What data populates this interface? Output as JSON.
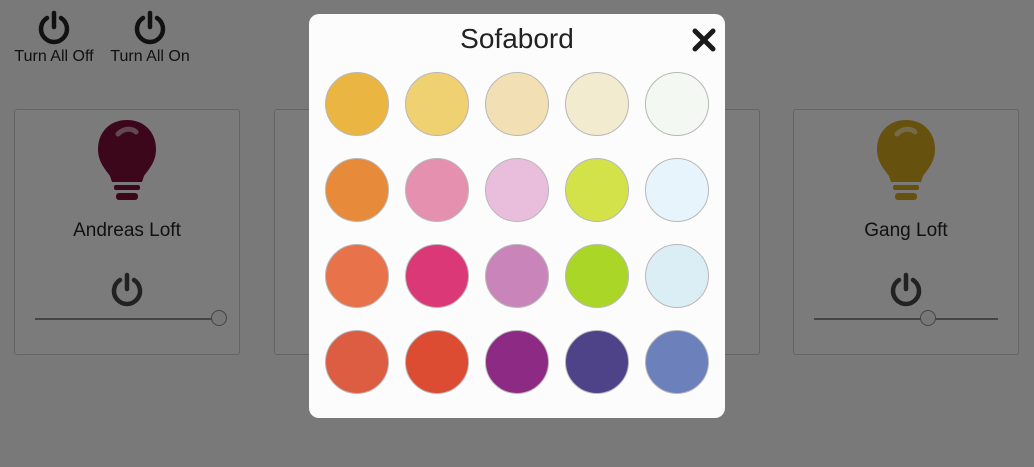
{
  "toolbar": {
    "turn_all_off_label": "Turn All Off",
    "turn_all_on_label": "Turn All On"
  },
  "cards": [
    {
      "name": "Andreas Loft",
      "bulb_color": "#7b0f36",
      "brightness": 1.0
    },
    {
      "name": "Gang Loft",
      "bulb_color": "#cfa31c",
      "brightness": 0.62
    }
  ],
  "modal": {
    "title": "Sofabord",
    "close_icon": "close-icon",
    "colors": [
      [
        "#eab541",
        "#efd171",
        "#f2e0b4",
        "#f2ebcf",
        "#f4f8f3"
      ],
      [
        "#e78a39",
        "#e690b0",
        "#e9bedc",
        "#d4e249",
        "#e8f4fb"
      ],
      [
        "#e8734a",
        "#db3878",
        "#c985b9",
        "#a9d627",
        "#dbeef6"
      ],
      [
        "#dc5d42",
        "#db4c32",
        "#8d2a83",
        "#4e4389",
        "#6c81bc"
      ]
    ]
  }
}
